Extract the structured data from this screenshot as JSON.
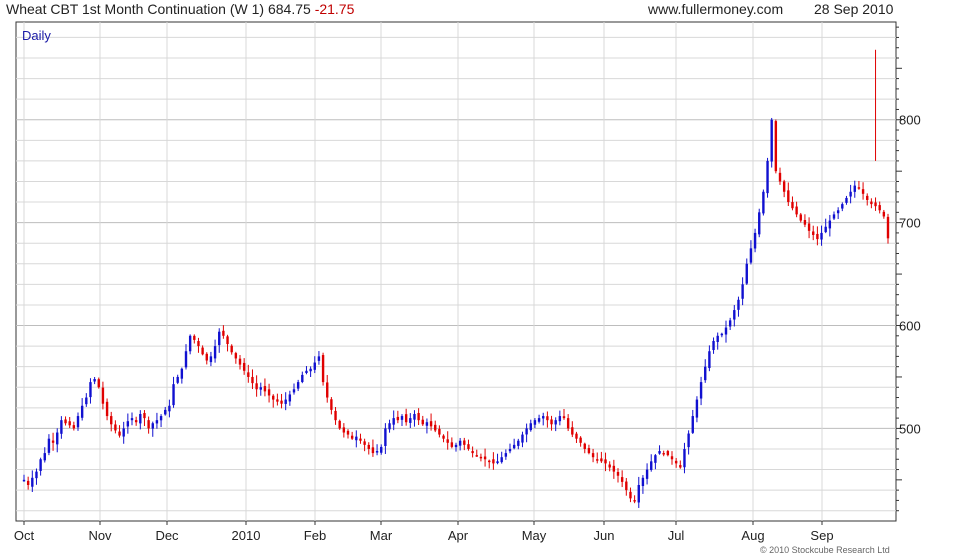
{
  "header": {
    "instrument": "Wheat CBT 1st Month Continuation (W 1)",
    "last": "684.75",
    "change": "-21.75",
    "source": "www.fullermoney.com",
    "date": "28 Sep 2010"
  },
  "copyright": "© 2010 Stockcube Research Ltd",
  "colors": {
    "up": "#1010d0",
    "down": "#e00000",
    "grid": "#d8d8d8",
    "grid_major": "#bdbdbd"
  },
  "chart_data": {
    "type": "candlestick",
    "period_label": "Daily",
    "x_tick_labels": [
      "Oct",
      "Nov",
      "Dec",
      "2010",
      "Feb",
      "Mar",
      "Apr",
      "May",
      "Jun",
      "Jul",
      "Aug",
      "Sep"
    ],
    "y_tick_labels": [
      "500",
      "600",
      "700",
      "800"
    ],
    "y_ticks": [
      500,
      600,
      700,
      800
    ],
    "ylim": [
      410,
      895
    ],
    "grid": true,
    "close_series": [
      450,
      445,
      452,
      458,
      470,
      476,
      490,
      486,
      496,
      508,
      505,
      503,
      500,
      512,
      522,
      530,
      545,
      548,
      540,
      524,
      512,
      504,
      498,
      493,
      500,
      507,
      510,
      506,
      514,
      510,
      500,
      505,
      508,
      512,
      518,
      522,
      543,
      550,
      558,
      575,
      590,
      586,
      580,
      572,
      566,
      570,
      580,
      594,
      590,
      582,
      574,
      568,
      562,
      556,
      550,
      544,
      538,
      540,
      536,
      532,
      528,
      526,
      524,
      528,
      533,
      538,
      545,
      552,
      556,
      558,
      564,
      570,
      545,
      530,
      518,
      508,
      500,
      496,
      494,
      490,
      492,
      488,
      484,
      480,
      476,
      478,
      482,
      500,
      505,
      510,
      508,
      512,
      506,
      510,
      514,
      508,
      504,
      506,
      502,
      498,
      494,
      490,
      486,
      482,
      484,
      488,
      484,
      480,
      476,
      474,
      472,
      470,
      468,
      466,
      468,
      472,
      476,
      480,
      484,
      488,
      494,
      500,
      505,
      508,
      510,
      512,
      508,
      504,
      508,
      512,
      510,
      500,
      494,
      490,
      486,
      480,
      476,
      472,
      470,
      468,
      466,
      462,
      458,
      454,
      448,
      440,
      432,
      430,
      445,
      452,
      460,
      468,
      474,
      478,
      476,
      474,
      470,
      466,
      462,
      480,
      495,
      512,
      528,
      545,
      560,
      575,
      585,
      590,
      592,
      598,
      605,
      615,
      625,
      640,
      660,
      675,
      690,
      710,
      730,
      760,
      800,
      750,
      740,
      730,
      720,
      714,
      708,
      702,
      698,
      692,
      688,
      684,
      690,
      696,
      702,
      708,
      712,
      718,
      724,
      730,
      736,
      734,
      728,
      722,
      718,
      716,
      712,
      706,
      684.75
    ]
  }
}
